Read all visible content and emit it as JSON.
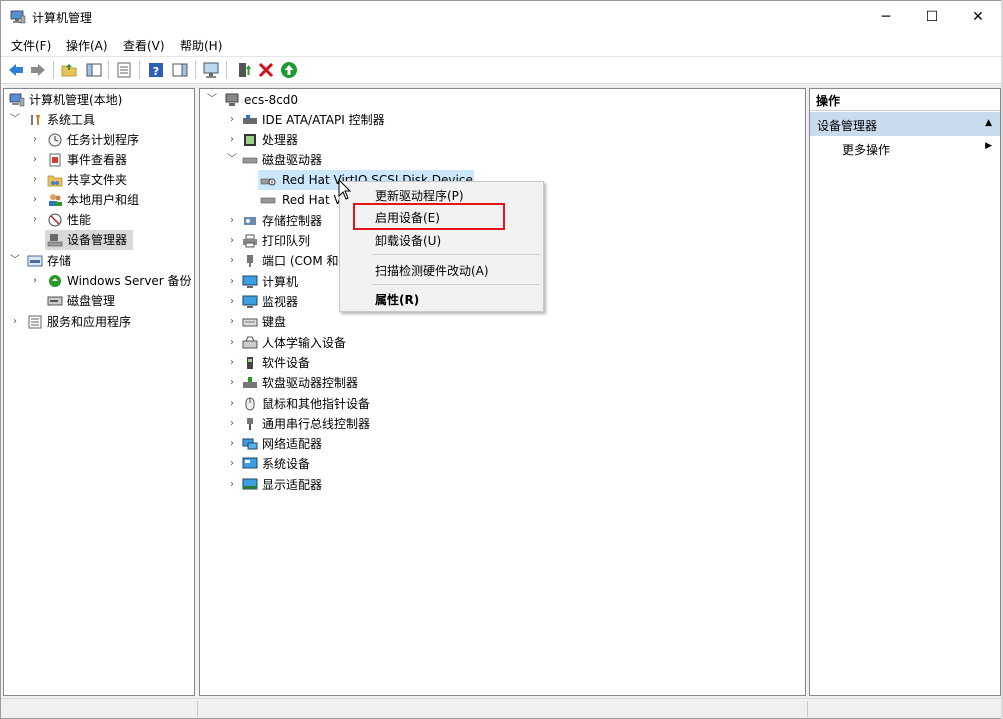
{
  "window": {
    "title": "计算机管理",
    "minimize": "─",
    "maximize": "☐",
    "close": "✕"
  },
  "menu": {
    "file": "文件(F)",
    "action": "操作(A)",
    "view": "查看(V)",
    "help": "帮助(H)"
  },
  "left_tree": {
    "root": "计算机管理(本地)",
    "system_tools": "系统工具",
    "task_scheduler": "任务计划程序",
    "event_viewer": "事件查看器",
    "shared_folders": "共享文件夹",
    "local_users": "本地用户和组",
    "performance": "性能",
    "device_manager": "设备管理器",
    "storage": "存储",
    "windows_backup": "Windows Server 备份",
    "disk_management": "磁盘管理",
    "services_apps": "服务和应用程序"
  },
  "device_tree": {
    "computer": "ecs-8cd0",
    "ide": "IDE ATA/ATAPI 控制器",
    "processor": "处理器",
    "disk_drives": "磁盘驱动器",
    "disk1": "Red Hat VirtIO SCSI Disk Device",
    "disk2": "Red Hat V",
    "storage_ctrl": "存储控制器",
    "print_queue": "打印队列",
    "ports": "端口 (COM 和",
    "computers": "计算机",
    "monitors": "监视器",
    "keyboard": "键盘",
    "hid": "人体学输入设备",
    "software": "软件设备",
    "floppy_ctrl": "软盘驱动器控制器",
    "mouse": "鼠标和其他指针设备",
    "usb": "通用串行总线控制器",
    "network": "网络适配器",
    "system": "系统设备",
    "display": "显示适配器"
  },
  "context_menu": {
    "update_driver": "更新驱动程序(P)",
    "enable_device": "启用设备(E)",
    "uninstall_device": "卸载设备(U)",
    "scan_changes": "扫描检测硬件改动(A)",
    "properties": "属性(R)"
  },
  "actions_pane": {
    "header": "操作",
    "selected": "设备管理器",
    "more": "更多操作"
  },
  "colors": {
    "accent": "#cce8ff",
    "highlight_box": "#e0161d",
    "action_sel": "#c9dcef"
  }
}
